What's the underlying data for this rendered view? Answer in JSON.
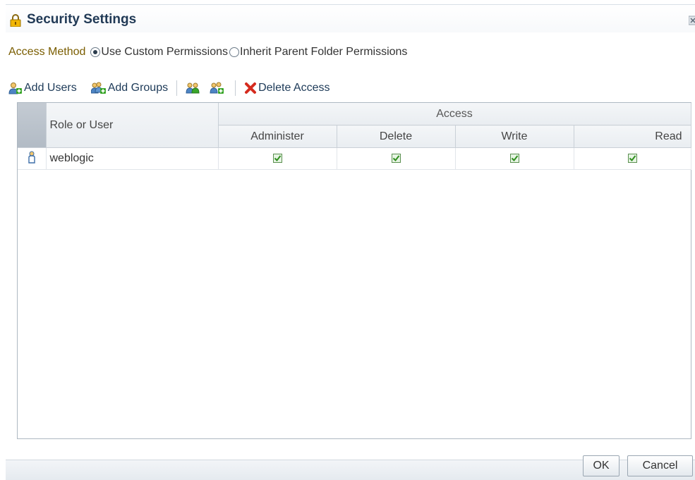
{
  "dialog": {
    "title": "Security Settings"
  },
  "access_method": {
    "label": "Access Method",
    "options": [
      {
        "label": "Use Custom Permissions",
        "selected": true
      },
      {
        "label": "Inherit Parent Folder Permissions",
        "selected": false
      }
    ]
  },
  "toolbar": {
    "add_users": "Add Users",
    "add_groups": "Add Groups",
    "delete_access": "Delete Access"
  },
  "table": {
    "role_header": "Role or User",
    "access_header": "Access",
    "columns": [
      "Administer",
      "Delete",
      "Write",
      "Read"
    ],
    "rows": [
      {
        "name": "weblogic",
        "icon": "user-icon",
        "administer": true,
        "delete": true,
        "write": true,
        "read": true
      }
    ]
  },
  "buttons": {
    "ok": "OK",
    "cancel": "Cancel"
  },
  "colors": {
    "title": "#213a56",
    "access_label": "#7a5d00",
    "delete_icon": "#d52b1e",
    "check_green": "#3aa62a"
  }
}
